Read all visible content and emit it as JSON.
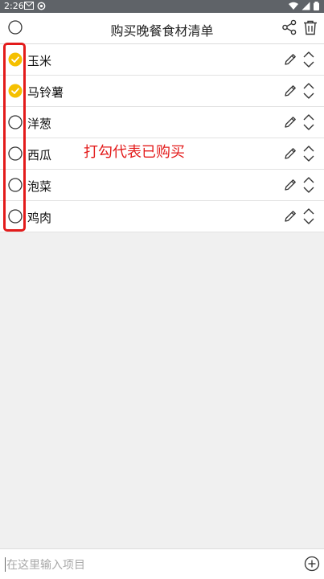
{
  "status_bar": {
    "time": "2:26"
  },
  "header": {
    "title": "购买晚餐食材清单"
  },
  "items": [
    {
      "label": "玉米",
      "checked": true
    },
    {
      "label": "马铃薯",
      "checked": true
    },
    {
      "label": "洋葱",
      "checked": false
    },
    {
      "label": "西瓜",
      "checked": false
    },
    {
      "label": "泡菜",
      "checked": false
    },
    {
      "label": "鸡肉",
      "checked": false
    }
  ],
  "annotation": "打勾代表已购买",
  "input": {
    "placeholder": "在这里输入项目",
    "value": ""
  },
  "colors": {
    "check_fill": "#f5c000",
    "annotation": "#e31b1b",
    "status_bar": "#5f6368"
  }
}
